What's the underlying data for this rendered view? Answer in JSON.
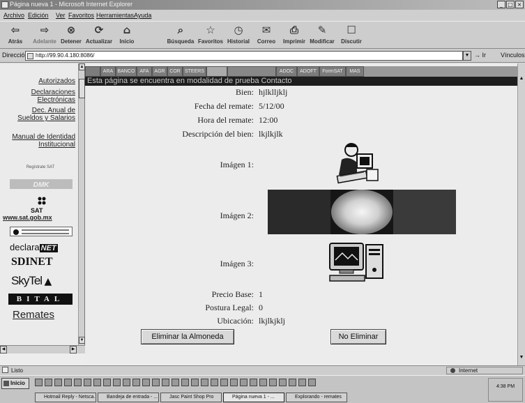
{
  "window": {
    "title": "Página nueva 1 - Microsoft Internet Explorer"
  },
  "menu": [
    "Archivo",
    "Edición",
    "Ver",
    "Favoritos",
    "Herramientas",
    "Ayuda"
  ],
  "toolbar": {
    "back": "Atrás",
    "forward": "Adelante",
    "stop": "Detener",
    "refresh": "Actualizar",
    "home": "Inicio",
    "search": "Búsqueda",
    "favorites": "Favoritos",
    "history": "Historial",
    "mail": "Correo",
    "print": "Imprimir",
    "edit": "Modificar",
    "discuss": "Discutir"
  },
  "address": {
    "label": "Dirección",
    "url": "http://99.90.4.180:8086/",
    "go": "Ir",
    "links": "Vínculos"
  },
  "sidebar": {
    "links": [
      "Autorizados",
      "Declaraciones Electrónicas",
      "Dec. Anual de Sueldos y Salarios",
      "Manual de Identidad Institucional"
    ],
    "register": "Regístrate SAT",
    "sat_label": "SAT",
    "sat_url": "www.sat.gob.mx",
    "declara": "declara",
    "declara_tag": "NET",
    "sdi": "SDINET",
    "skytel": "SkyTel",
    "bital": "BITAL",
    "remates": "Remates"
  },
  "navtabs": [
    "",
    "ARA",
    "BANCO",
    "AFA",
    "AGR",
    "COR",
    "STEERS",
    "",
    "",
    "ADOC",
    "ADOFT",
    "FormSAT",
    "MAS"
  ],
  "banner": "Esta página se encuentra en modalidad de prueba Contacto",
  "details": {
    "bien_label": "Bien:",
    "bien_value": "hjlklljklj",
    "fecha_label": "Fecha del remate:",
    "fecha_value": "5/12/00",
    "hora_label": "Hora del remate:",
    "hora_value": "12:00",
    "desc_label": "Descripción del bien:",
    "desc_value": "lkjlkjlk",
    "img1_label": "Imágen 1:",
    "img2_label": "Imágen 2:",
    "img3_label": "Imágen 3:",
    "precio_label": "Precio Base:",
    "precio_value": "1",
    "postura_label": "Postura Legal:",
    "postura_value": "0",
    "ubic_label": "Ubicación:",
    "ubic_value": "lkjlkjklj"
  },
  "buttons": {
    "eliminar": "Eliminar la Almoneda",
    "no_eliminar": "No Eliminar"
  },
  "status": {
    "text": "Listo",
    "zone": "Internet"
  },
  "taskbar": {
    "start": "Inicio",
    "tasks": [
      "Hotmail Reply - Netsca...",
      "Bandeja de entrada - ...",
      "Jasc Paint Shop Pro",
      "Página nueva 1 - ...",
      "Explorando - remates"
    ],
    "clock": "4:38 PM"
  }
}
